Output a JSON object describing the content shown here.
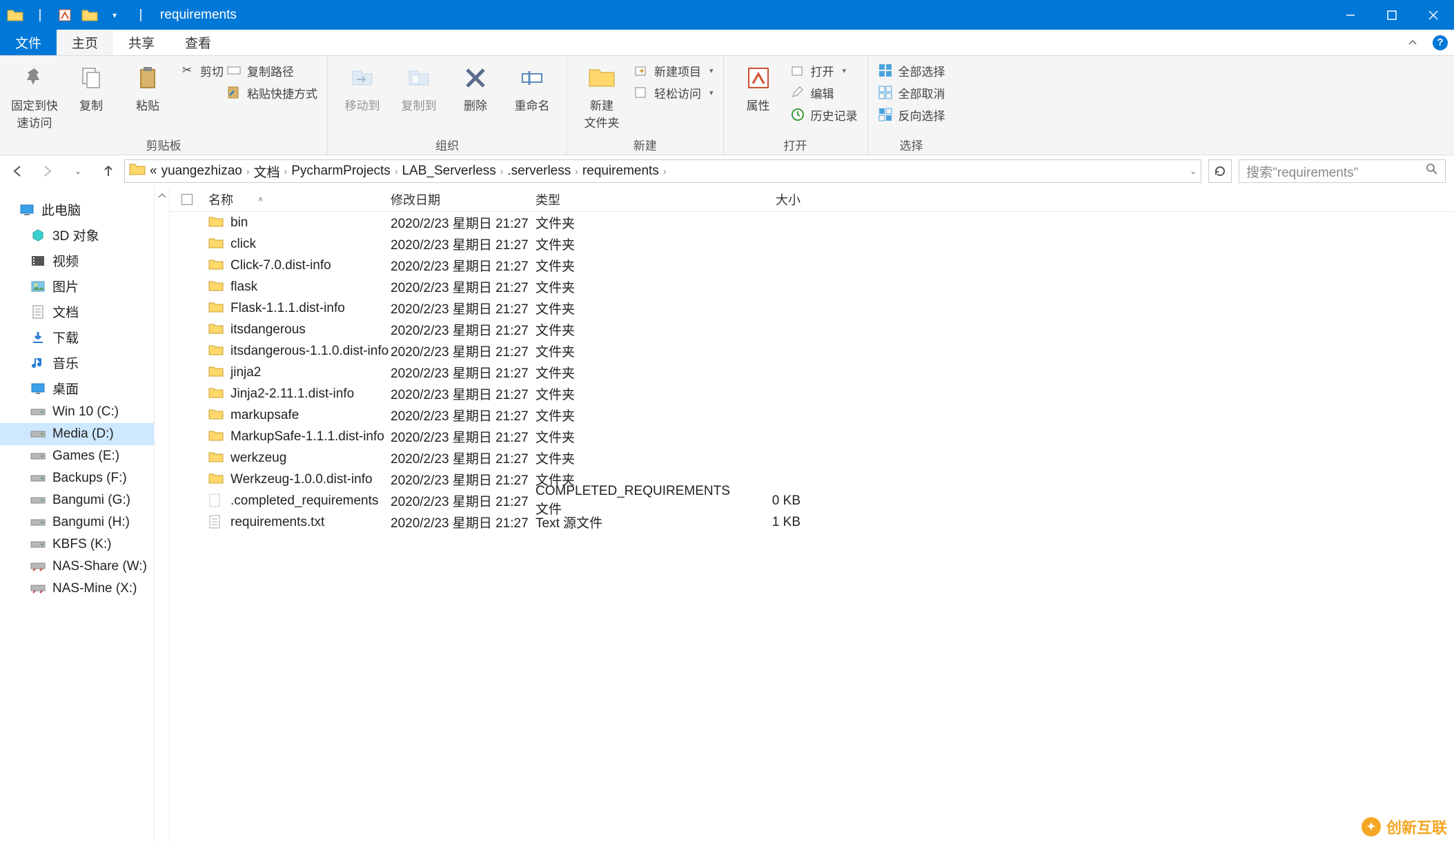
{
  "window": {
    "title": "requirements"
  },
  "tabs": {
    "file": "文件",
    "home": "主页",
    "share": "共享",
    "view": "查看"
  },
  "ribbon": {
    "clipboard": {
      "pin": "固定到快\n速访问",
      "copy": "复制",
      "paste": "粘贴",
      "cut": "剪切",
      "copypath": "复制路径",
      "pasteshortcut": "粘贴快捷方式",
      "label": "剪贴板"
    },
    "organize": {
      "moveto": "移动到",
      "copyto": "复制到",
      "delete": "删除",
      "rename": "重命名",
      "label": "组织"
    },
    "new": {
      "newfolder": "新建\n文件夹",
      "newitem": "新建项目",
      "easyaccess": "轻松访问",
      "label": "新建"
    },
    "open": {
      "properties": "属性",
      "open": "打开",
      "edit": "编辑",
      "history": "历史记录",
      "label": "打开"
    },
    "select": {
      "selectall": "全部选择",
      "selectnone": "全部取消",
      "invert": "反向选择",
      "label": "选择"
    }
  },
  "breadcrumb": {
    "prefix": "«",
    "items": [
      "yuangezhizao",
      "文档",
      "PycharmProjects",
      "LAB_Serverless",
      ".serverless",
      "requirements"
    ]
  },
  "search": {
    "placeholder": "搜索\"requirements\""
  },
  "sidebar": {
    "items": [
      {
        "label": "此电脑",
        "icon": "pc",
        "indent": false
      },
      {
        "label": "3D 对象",
        "icon": "3d",
        "indent": true
      },
      {
        "label": "视频",
        "icon": "video",
        "indent": true
      },
      {
        "label": "图片",
        "icon": "picture",
        "indent": true
      },
      {
        "label": "文档",
        "icon": "document",
        "indent": true
      },
      {
        "label": "下载",
        "icon": "download",
        "indent": true
      },
      {
        "label": "音乐",
        "icon": "music",
        "indent": true
      },
      {
        "label": "桌面",
        "icon": "desktop",
        "indent": true
      },
      {
        "label": "Win 10 (C:)",
        "icon": "drive",
        "indent": true
      },
      {
        "label": "Media (D:)",
        "icon": "drive",
        "indent": true,
        "selected": true
      },
      {
        "label": "Games (E:)",
        "icon": "drive",
        "indent": true
      },
      {
        "label": "Backups (F:)",
        "icon": "drive",
        "indent": true
      },
      {
        "label": "Bangumi (G:)",
        "icon": "drive",
        "indent": true
      },
      {
        "label": "Bangumi (H:)",
        "icon": "drive",
        "indent": true
      },
      {
        "label": "KBFS (K:)",
        "icon": "drive",
        "indent": true
      },
      {
        "label": "NAS-Share (W:)",
        "icon": "netdrive",
        "indent": true
      },
      {
        "label": "NAS-Mine (X:)",
        "icon": "netdrive",
        "indent": true
      }
    ]
  },
  "columns": {
    "name": "名称",
    "date": "修改日期",
    "type": "类型",
    "size": "大小"
  },
  "files": [
    {
      "name": "bin",
      "date": "2020/2/23 星期日 21:27",
      "type": "文件夹",
      "size": "",
      "icon": "folder"
    },
    {
      "name": "click",
      "date": "2020/2/23 星期日 21:27",
      "type": "文件夹",
      "size": "",
      "icon": "folder"
    },
    {
      "name": "Click-7.0.dist-info",
      "date": "2020/2/23 星期日 21:27",
      "type": "文件夹",
      "size": "",
      "icon": "folder"
    },
    {
      "name": "flask",
      "date": "2020/2/23 星期日 21:27",
      "type": "文件夹",
      "size": "",
      "icon": "folder"
    },
    {
      "name": "Flask-1.1.1.dist-info",
      "date": "2020/2/23 星期日 21:27",
      "type": "文件夹",
      "size": "",
      "icon": "folder"
    },
    {
      "name": "itsdangerous",
      "date": "2020/2/23 星期日 21:27",
      "type": "文件夹",
      "size": "",
      "icon": "folder"
    },
    {
      "name": "itsdangerous-1.1.0.dist-info",
      "date": "2020/2/23 星期日 21:27",
      "type": "文件夹",
      "size": "",
      "icon": "folder"
    },
    {
      "name": "jinja2",
      "date": "2020/2/23 星期日 21:27",
      "type": "文件夹",
      "size": "",
      "icon": "folder"
    },
    {
      "name": "Jinja2-2.11.1.dist-info",
      "date": "2020/2/23 星期日 21:27",
      "type": "文件夹",
      "size": "",
      "icon": "folder"
    },
    {
      "name": "markupsafe",
      "date": "2020/2/23 星期日 21:27",
      "type": "文件夹",
      "size": "",
      "icon": "folder"
    },
    {
      "name": "MarkupSafe-1.1.1.dist-info",
      "date": "2020/2/23 星期日 21:27",
      "type": "文件夹",
      "size": "",
      "icon": "folder"
    },
    {
      "name": "werkzeug",
      "date": "2020/2/23 星期日 21:27",
      "type": "文件夹",
      "size": "",
      "icon": "folder"
    },
    {
      "name": "Werkzeug-1.0.0.dist-info",
      "date": "2020/2/23 星期日 21:27",
      "type": "文件夹",
      "size": "",
      "icon": "folder"
    },
    {
      "name": ".completed_requirements",
      "date": "2020/2/23 星期日 21:27",
      "type": "COMPLETED_REQUIREMENTS 文件",
      "size": "0 KB",
      "icon": "file"
    },
    {
      "name": "requirements.txt",
      "date": "2020/2/23 星期日 21:27",
      "type": "Text 源文件",
      "size": "1 KB",
      "icon": "text"
    }
  ],
  "watermark": "创新互联"
}
